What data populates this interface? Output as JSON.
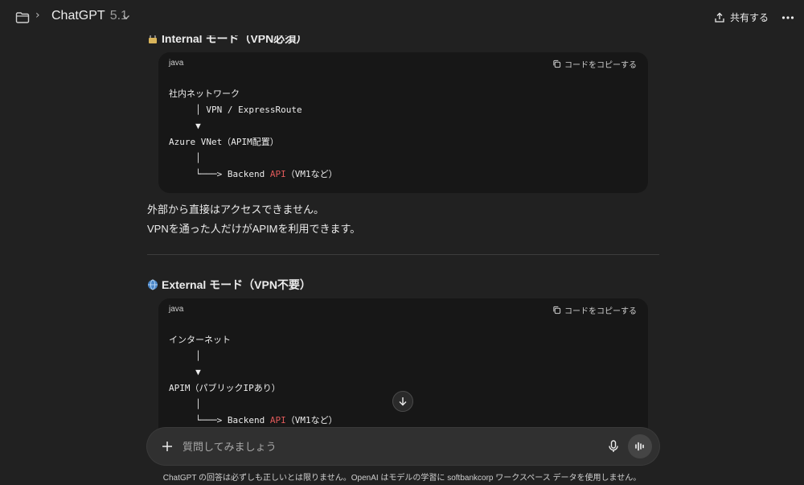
{
  "topbar": {
    "title": "ChatGPT",
    "version": "5.1",
    "share_label": "共有する"
  },
  "sections": [
    {
      "heading": "Internal モード（VPN必須）",
      "code": {
        "lang": "java",
        "copy_label": "コードをコピーする",
        "lines": [
          "社内ネットワーク",
          "     │ VPN / ExpressRoute",
          "     ▼",
          "Azure VNet（APIM配置）",
          "     │",
          "     └───> Backend ",
          ""
        ]
      },
      "paragraphs": [
        "外部から直接はアクセスできません。",
        "VPNを通った人だけがAPIMを利用できます。"
      ]
    },
    {
      "heading": "External モード（VPN不要）",
      "code": {
        "lang": "java",
        "copy_label": "コードをコピーする",
        "lines": [
          "インターネット",
          "     │",
          "     ▼",
          "APIM（パブリックIPあり）",
          "     │",
          "     └───> Backend "
        ]
      }
    }
  ],
  "backend_api_keyword": "API",
  "backend_suffix": "（VM1など）",
  "composer": {
    "placeholder": "質問してみましょう"
  },
  "footer_note": "ChatGPT の回答は必ずしも正しいとは限りません。OpenAI はモデルの学習に softbankcorp ワークスペース データを使用しません。",
  "icons": {
    "folder": "folder-icon",
    "chevron_right": "chevron-right-icon",
    "chevron_down": "chevron-down-icon",
    "share": "share-icon",
    "more": "more-icon",
    "copy": "copy-icon",
    "plus": "plus-icon",
    "mic": "microphone-icon",
    "voice": "voice-mode-icon",
    "arrow_down": "arrow-down-icon",
    "lock": "lock-icon",
    "globe": "globe-icon"
  },
  "colors": {
    "background": "#212121",
    "code_background": "#171717",
    "keyword": "#e15a5a"
  }
}
